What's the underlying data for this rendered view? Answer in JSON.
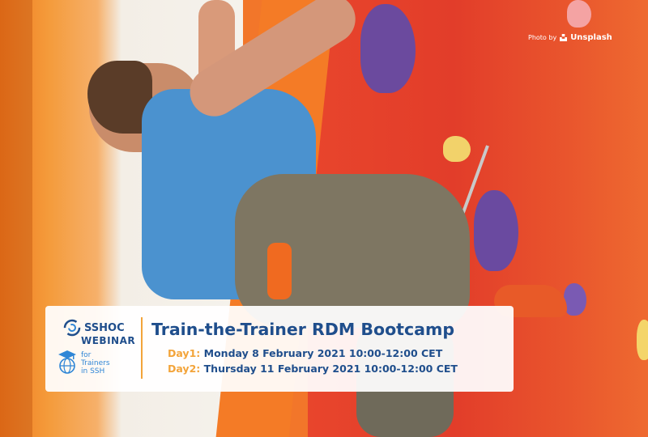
{
  "credit": {
    "prefix": "Photo by",
    "brand": "Unsplash"
  },
  "banner": {
    "logo": {
      "name": "SSHOC",
      "subtitle": "WEBINAR",
      "trainers_line1": "for",
      "trainers_line2": "Trainers",
      "trainers_line3": "in SSH"
    },
    "title": "Train-the-Trainer RDM Bootcamp",
    "day1": {
      "label": "Day1:",
      "text": "Monday  8  February 2021 10:00-12:00 CET"
    },
    "day2": {
      "label": "Day2:",
      "text": "Thursday 11 February 2021 10:00-12:00 CET"
    }
  },
  "colors": {
    "brand_blue": "#1f4e8c",
    "accent_orange": "#f3a43a",
    "light_blue": "#2f86d6",
    "wall_red": "#e23d2a"
  }
}
